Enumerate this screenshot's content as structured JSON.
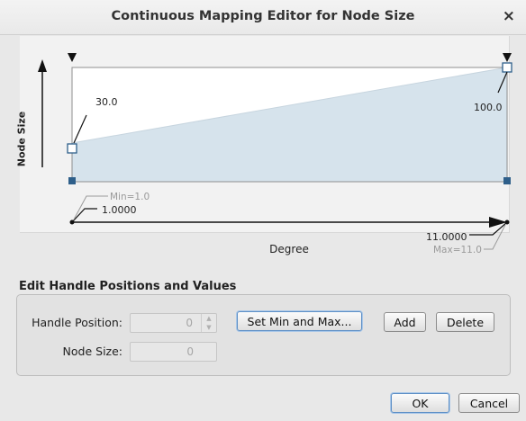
{
  "window": {
    "title": "Continuous Mapping Editor for Node Size",
    "close_glyph": "×"
  },
  "editor": {
    "y_axis_label": "Node Size",
    "x_axis_label": "Degree",
    "left_handle_value": "30.0",
    "right_handle_value": "100.0",
    "left_range_value": "1.0000",
    "right_range_value": "11.0000",
    "min_label": "Min=1.0",
    "max_label": "Max=11.0"
  },
  "edit_panel": {
    "section_title": "Edit Handle Positions and Values",
    "handle_position_label": "Handle Position:",
    "handle_position_value": "0",
    "node_size_label": "Node Size:",
    "node_size_value": "0",
    "set_min_max_label": "Set Min and Max...",
    "add_label": "Add",
    "delete_label": "Delete"
  },
  "footer": {
    "ok_label": "OK",
    "cancel_label": "Cancel"
  },
  "colors": {
    "fill": "#d6e3ec",
    "handle": "#2e5f8a"
  }
}
